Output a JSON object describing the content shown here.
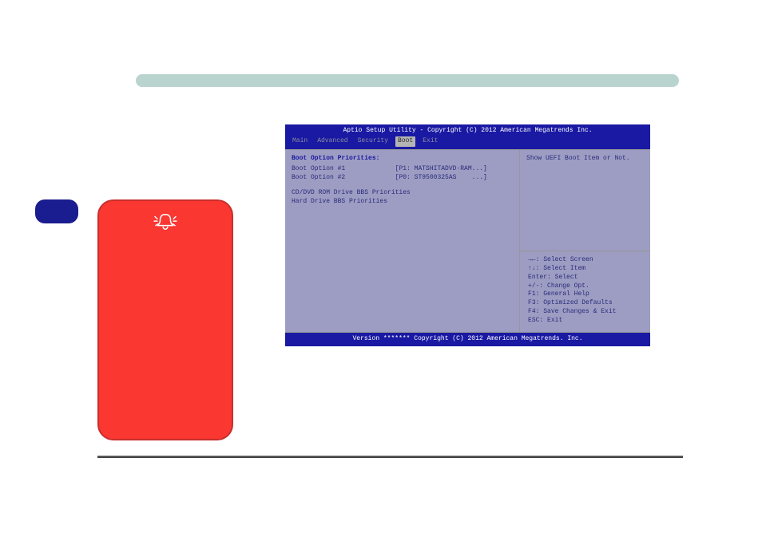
{
  "bios": {
    "title": "Aptio Setup Utility - Copyright (C) 2012 American Megatrends Inc.",
    "tabs": [
      "Main",
      "Advanced",
      "Security",
      "Boot",
      "Exit"
    ],
    "active_tab_index": 3,
    "left": {
      "header": "Boot Option Priorities:",
      "opt1_label": "Boot Option #1",
      "opt1_value": "[P1: MATSHITADVD-RAM...]",
      "opt2_label": "Boot Option #2",
      "opt2_value": "[P0: ST9500325AS    ...]",
      "sub1": "CD/DVD ROM Drive BBS Priorities",
      "sub2": "Hard Drive BBS Priorities"
    },
    "right_top": "Show UEFI Boot Item or Not.",
    "right_bottom": "→←: Select Screen\n↑↓: Select Item\nEnter: Select\n+/-: Change Opt.\nF1: General Help\nF3: Optimized Defaults\nF4: Save Changes & Exit\nESC: Exit",
    "footer": "Version ******* Copyright (C) 2012 American Megatrends. Inc."
  }
}
